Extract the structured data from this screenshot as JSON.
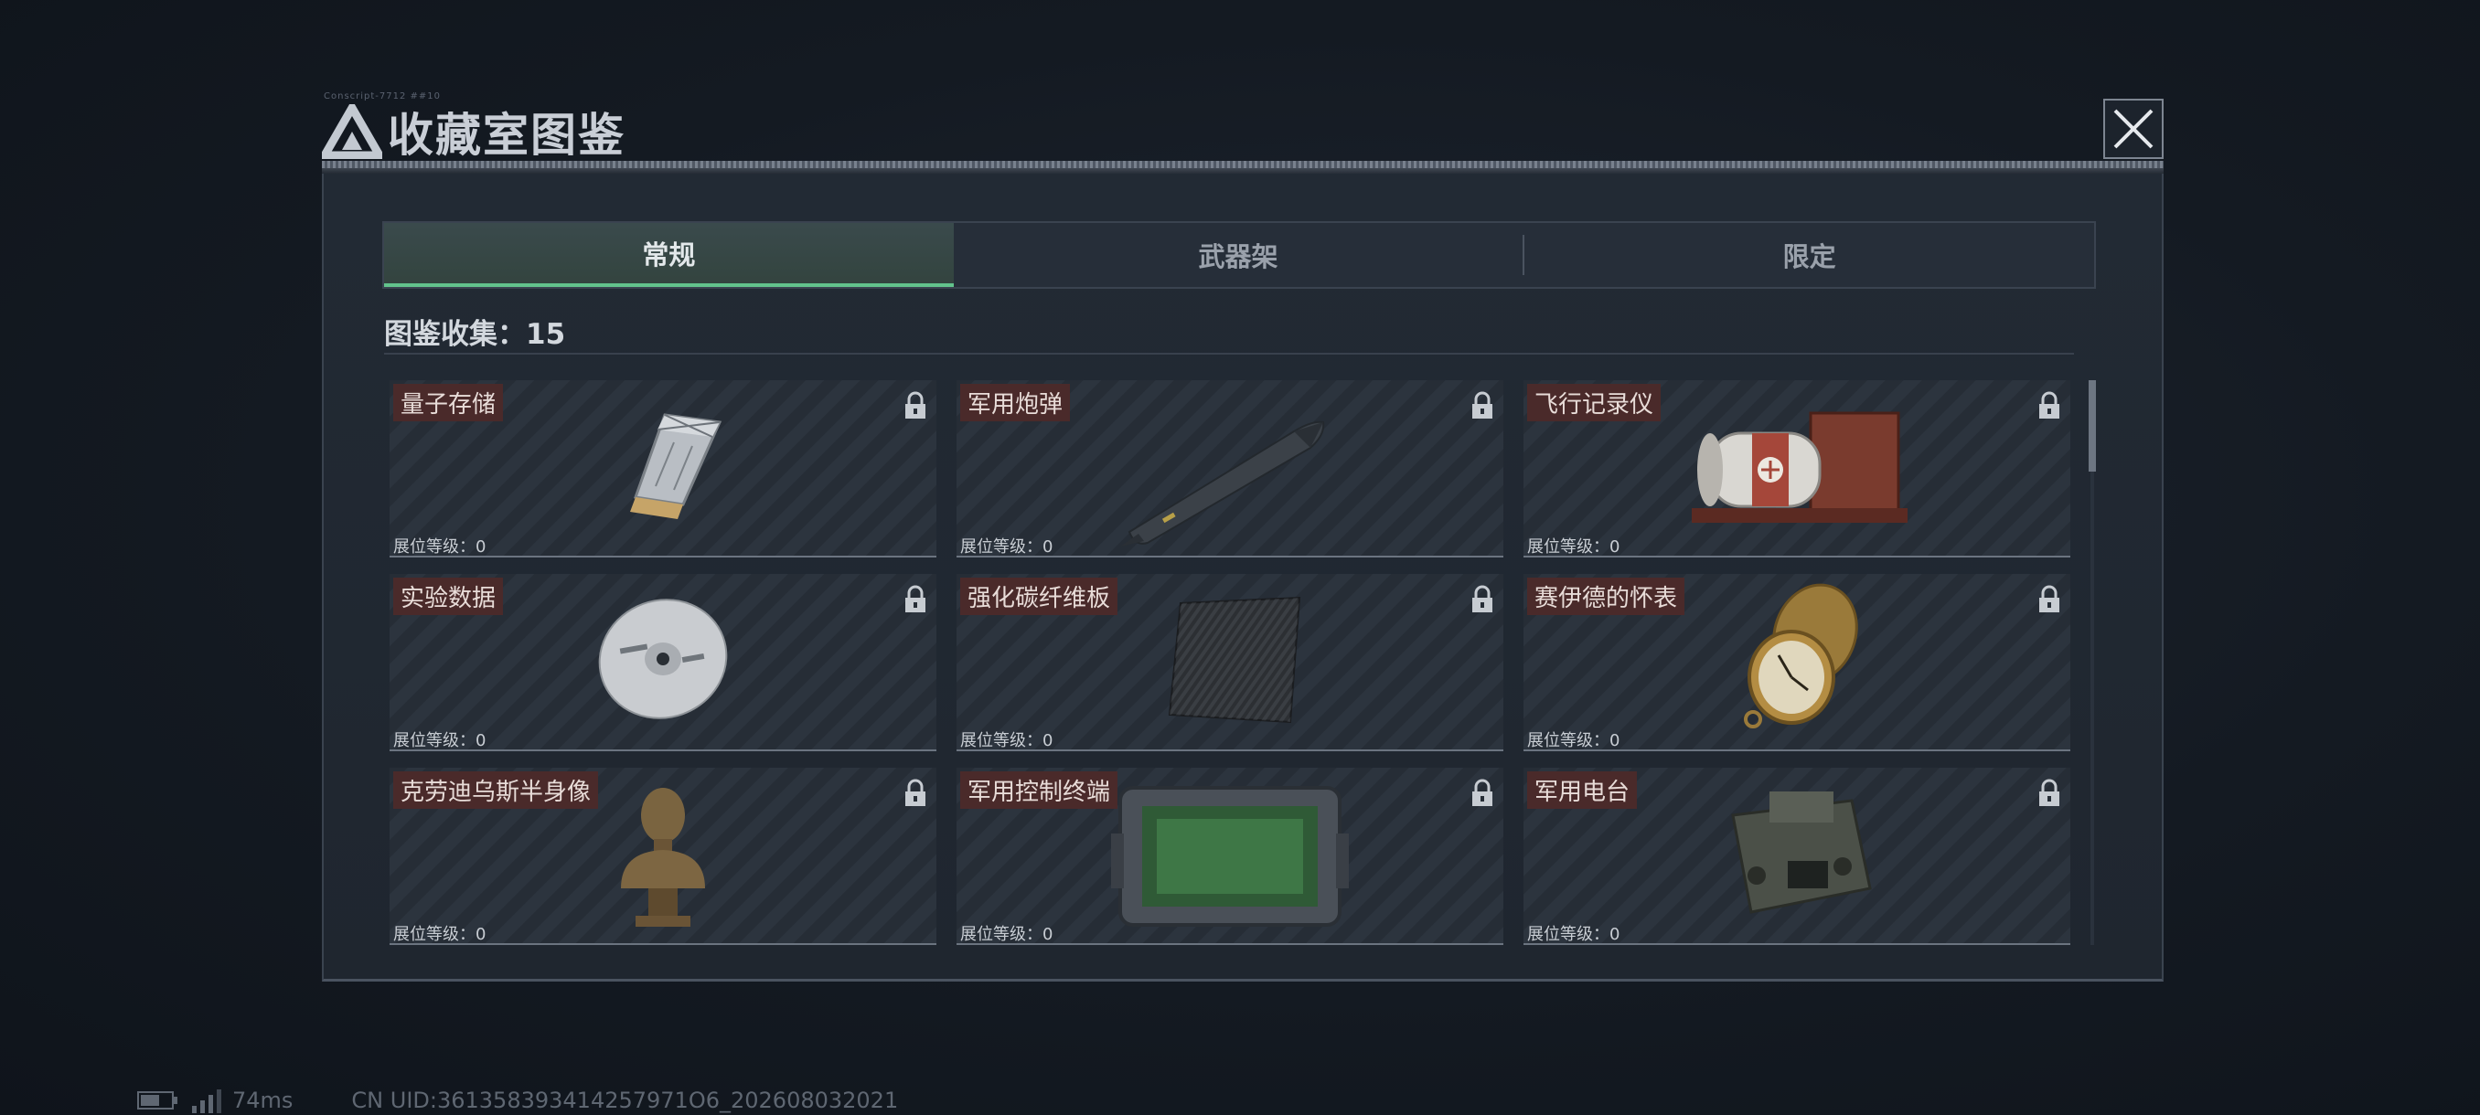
{
  "header": {
    "title": "收藏室图鉴",
    "small_text": "Conscript-7712 ##10"
  },
  "tabs": [
    {
      "label": "常规",
      "active": true
    },
    {
      "label": "武器架",
      "active": false
    },
    {
      "label": "限定",
      "active": false
    }
  ],
  "collection": {
    "label": "图鉴收集：15"
  },
  "items": [
    {
      "name": "量子存储",
      "level": "展位等级：0",
      "icon": "usb-drive-icon",
      "locked": true
    },
    {
      "name": "军用炮弹",
      "level": "展位等级：0",
      "icon": "missile-icon",
      "locked": true
    },
    {
      "name": "飞行记录仪",
      "level": "展位等级：0",
      "icon": "flight-recorder-icon",
      "locked": true
    },
    {
      "name": "实验数据",
      "level": "展位等级：0",
      "icon": "disc-icon",
      "locked": true
    },
    {
      "name": "强化碳纤维板",
      "level": "展位等级：0",
      "icon": "carbon-plate-icon",
      "locked": true
    },
    {
      "name": "赛伊德的怀表",
      "level": "展位等级：0",
      "icon": "pocket-watch-icon",
      "locked": true
    },
    {
      "name": "克劳迪乌斯半身像",
      "level": "展位等级：0",
      "icon": "bust-icon",
      "locked": true
    },
    {
      "name": "军用控制终端",
      "level": "展位等级：0",
      "icon": "control-terminal-icon",
      "locked": true
    },
    {
      "name": "军用电台",
      "level": "展位等级：0",
      "icon": "radio-icon",
      "locked": true
    }
  ],
  "status_bar": {
    "ping": "74ms",
    "uid": "CN UID:361358393414257971O6_202608032021"
  },
  "colors": {
    "accent": "#62c38c",
    "name_tag": "#4a2a2a"
  }
}
